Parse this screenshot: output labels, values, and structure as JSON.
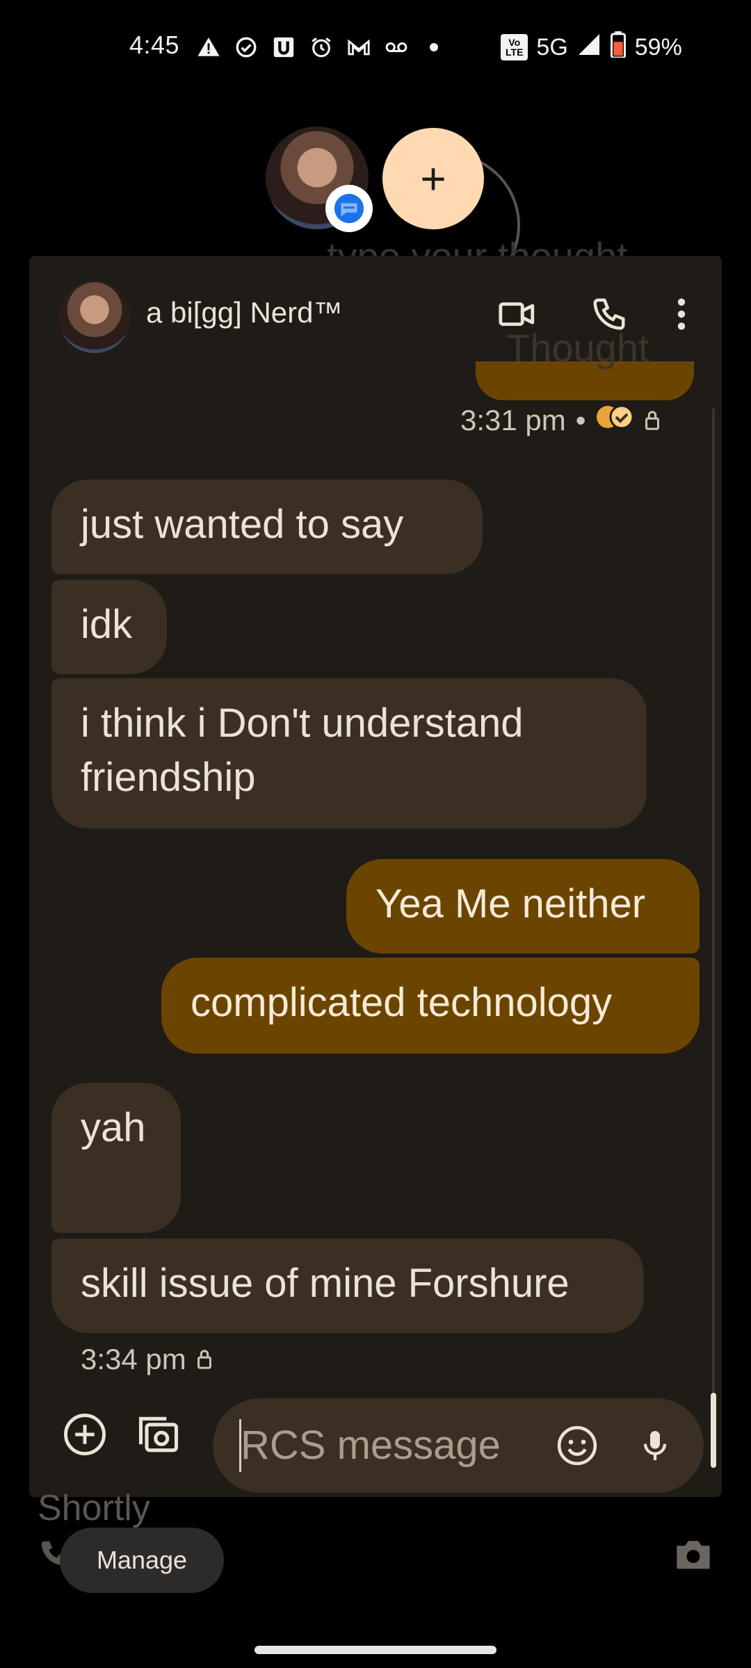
{
  "status_bar": {
    "time": "4:45",
    "network": "5G",
    "battery": "59%",
    "volte": "Vo\nLTE"
  },
  "bubble_cluster": {
    "plus_label": "+",
    "ghost_text": "type your thought"
  },
  "chat": {
    "contact_name": "a bi[gg] Nerd™",
    "ghost_thought": "Thought",
    "sent_meta_time": "3:31 pm",
    "sent_meta_separator": "•",
    "messages": [
      {
        "dir": "in",
        "text": "just wanted to say"
      },
      {
        "dir": "in",
        "text": "idk"
      },
      {
        "dir": "in",
        "text": "i think i Don't understand friendship"
      },
      {
        "dir": "out",
        "text": "Yea Me neither"
      },
      {
        "dir": "out",
        "text": "complicated technology"
      },
      {
        "dir": "in",
        "text": "yah"
      },
      {
        "dir": "in",
        "text": "skill issue of mine Forshure"
      }
    ],
    "last_meta_time": "3:34 pm"
  },
  "composer": {
    "placeholder": "RCS message"
  },
  "below": {
    "ghost_text": "Shortly",
    "manage_label": "Manage"
  },
  "colors": {
    "chat_bg": "#1f1b16",
    "incoming_bubble": "#3a2f22",
    "outgoing_bubble": "#6b4500",
    "accent_peach": "#ffd9b1"
  }
}
